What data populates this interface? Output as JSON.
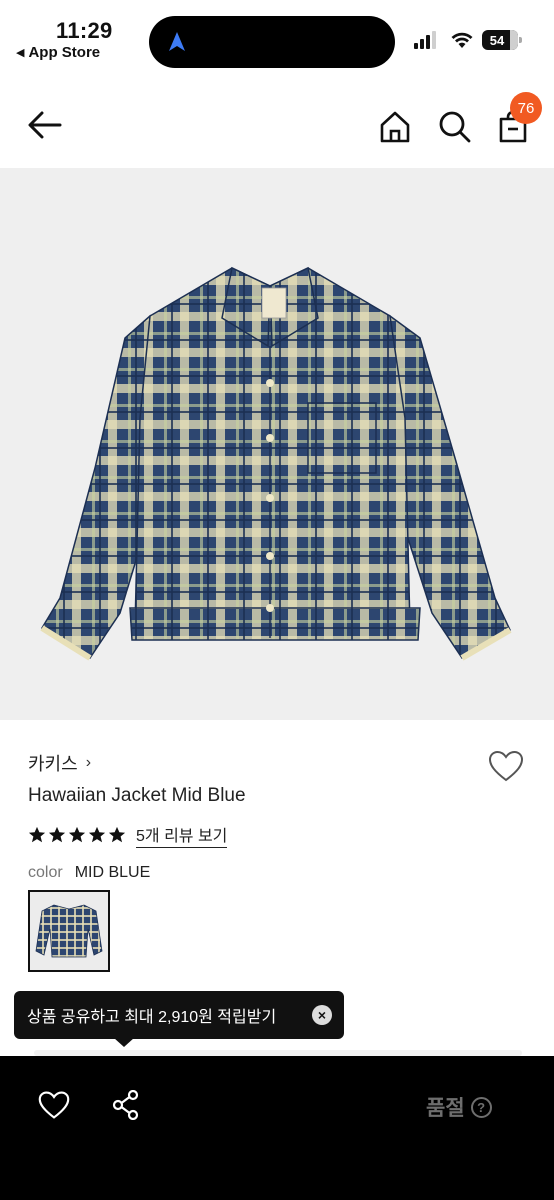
{
  "status_bar": {
    "time": "11:29",
    "back_app": "App Store",
    "battery": "54"
  },
  "nav": {
    "cart_count": "76",
    "icons": [
      "back-arrow-icon",
      "home-icon",
      "search-icon",
      "shopping-bag-icon"
    ]
  },
  "product": {
    "image": "plaid-jacket-photo",
    "brand": "카키스",
    "name": "Hawaiian Jacket Mid Blue",
    "rating": 5,
    "review_link": "5개 리뷰 보기",
    "color_label": "color",
    "color_value": "MID BLUE"
  },
  "tooltip": {
    "text": "상품 공유하고 최대 2,910원 적립받기"
  },
  "bottom_bar": {
    "status": "품절",
    "help_symbol": "?"
  },
  "colors": {
    "accent": "#f15a22",
    "plaid_navy": "#2d4670",
    "plaid_cream": "#e8e0b8"
  }
}
